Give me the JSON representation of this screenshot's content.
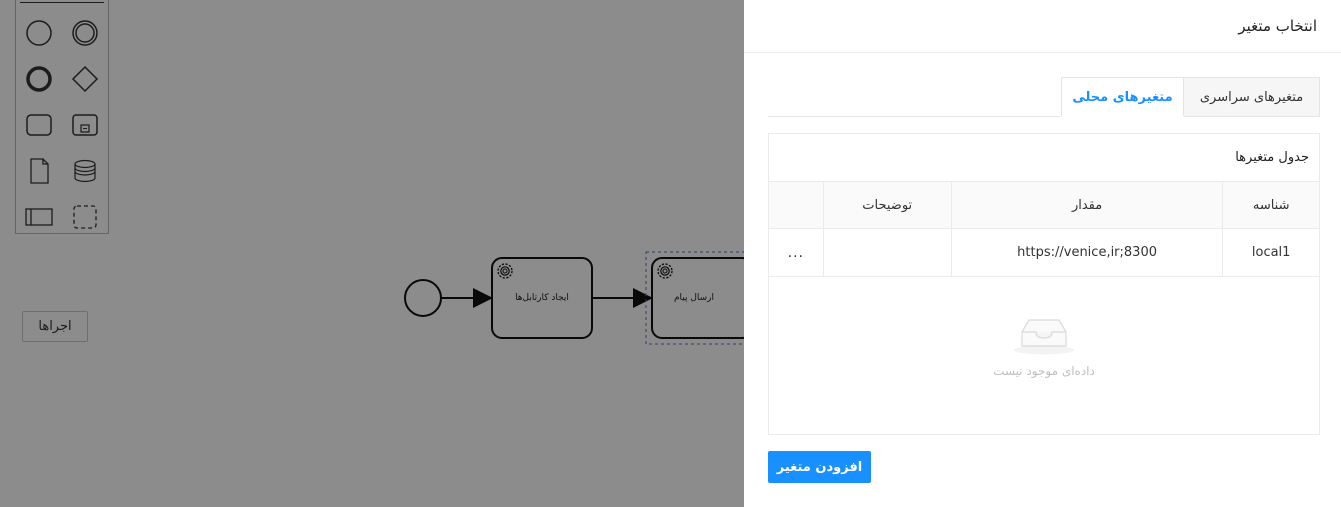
{
  "canvas": {
    "palette": {
      "items": [
        {
          "icon": "start-event-icon"
        },
        {
          "icon": "intermediate-event-icon"
        },
        {
          "icon": "end-event-icon"
        },
        {
          "icon": "gateway-icon"
        },
        {
          "icon": "task-icon"
        },
        {
          "icon": "subprocess-icon"
        },
        {
          "icon": "data-object-icon"
        },
        {
          "icon": "data-store-icon"
        },
        {
          "icon": "pool-icon"
        },
        {
          "icon": "group-icon"
        }
      ]
    },
    "runs_button_label": "اجراها",
    "tasks": [
      {
        "label": "ایجاد کارتابل‌ها"
      },
      {
        "label": "ارسال پیام"
      }
    ]
  },
  "drawer": {
    "title": "انتخاب متغیر",
    "tabs": [
      {
        "label": "متغیرهای سراسری",
        "active": false
      },
      {
        "label": "متغیرهای محلی",
        "active": true
      }
    ],
    "table": {
      "caption": "جدول متغیرها",
      "columns": [
        "شناسه",
        "مقدار",
        "توضیحات",
        ""
      ],
      "rows": [
        {
          "id": "local1",
          "value": "https://venice,ir;8300",
          "description": "",
          "actions": "..."
        }
      ],
      "empty_text": "داده‌ای موجود نیست"
    },
    "add_button_label": "افزودن متغیر"
  },
  "colors": {
    "accent": "#1890ff",
    "overlay": "rgba(0,0,0,0.45)"
  }
}
